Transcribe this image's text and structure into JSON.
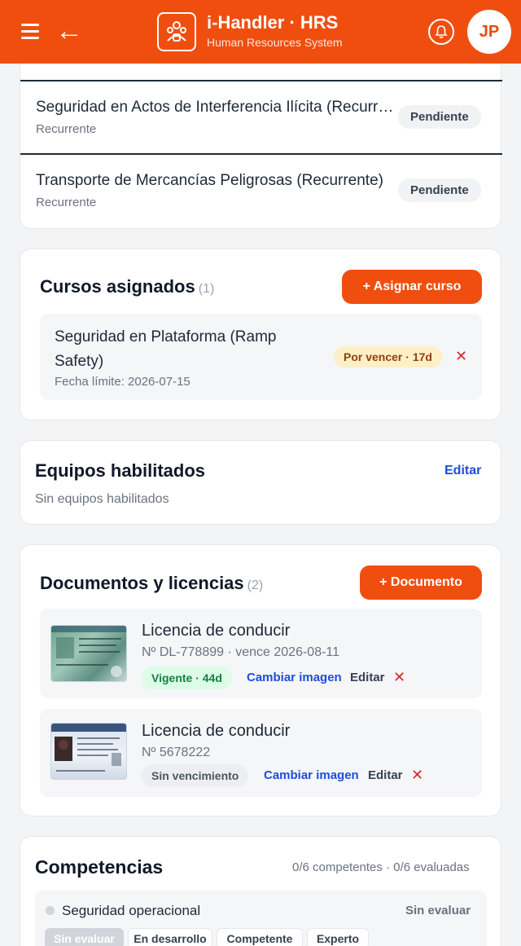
{
  "header": {
    "app_title": "i-Handler · HRS",
    "app_subtitle": "Human Resources System",
    "avatar_initials": "JP",
    "back_arrow": "←",
    "brand_color": "#f04e0f"
  },
  "training_list": {
    "items": [
      {
        "title": "Seguridad en Actos de Interferencia Ilícita (Recurrente)",
        "subtitle": "Recurrente",
        "status": "Pendiente"
      },
      {
        "title": "Transporte de Mercancías Peligrosas (Recurrente)",
        "subtitle": "Recurrente",
        "status": "Pendiente"
      }
    ]
  },
  "assigned_courses": {
    "title": "Cursos asignados",
    "count": "(1)",
    "add_button": "+ Asignar curso",
    "items": [
      {
        "title_line1": "Seguridad en Plataforma (Ramp",
        "title_line2": "Safety)",
        "deadline": "Fecha límite: 2026-07-15",
        "badge": "Por vencer · 17d",
        "remove": "✕"
      }
    ]
  },
  "equipment": {
    "title": "Equipos habilitados",
    "edit_label": "Editar",
    "empty_text": "Sin equipos habilitados"
  },
  "documents": {
    "title": "Documentos y licencias",
    "count": "(2)",
    "add_button": "+ Documento",
    "items": [
      {
        "name": "Licencia de conducir",
        "meta": "Nº DL-778899 · vence 2026-08-11",
        "badge": "Vigente · 44d",
        "change_image": "Cambiar imagen",
        "edit": "Editar",
        "remove": "✕",
        "thumb_icon": "id-card-icon"
      },
      {
        "name": "Licencia de conducir",
        "meta": "Nº 5678222",
        "badge": "Sin vencimiento",
        "change_image": "Cambiar imagen",
        "edit": "Editar",
        "remove": "✕",
        "thumb_icon": "ny-license-icon"
      }
    ]
  },
  "competencies": {
    "title": "Competencias",
    "summary": "0/6 competentes · 0/6 evaluadas",
    "items": [
      {
        "name": "Seguridad operacional",
        "status": "Sin evaluar",
        "levels": [
          "Sin evaluar",
          "En desarrollo",
          "Competente",
          "Experto"
        ]
      }
    ]
  }
}
